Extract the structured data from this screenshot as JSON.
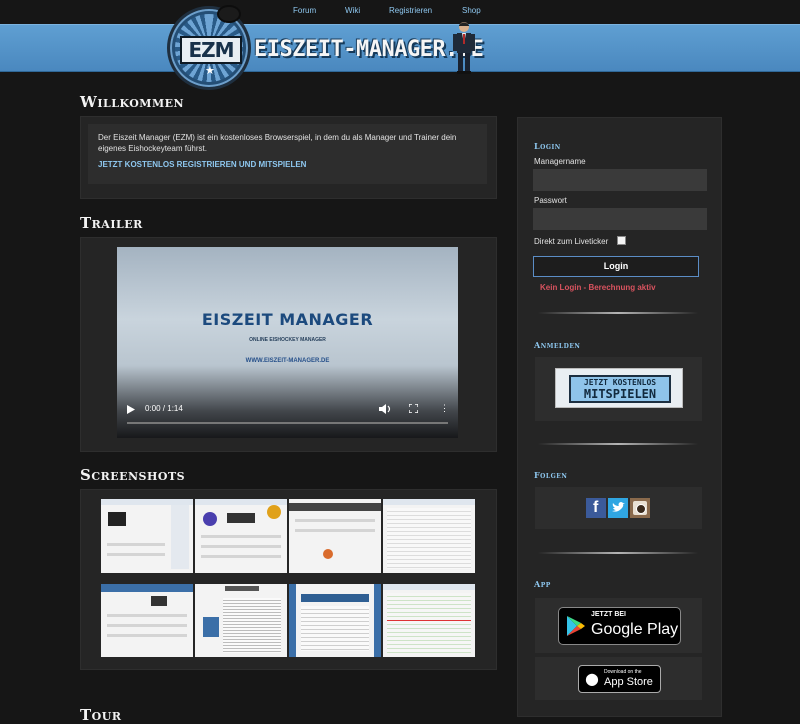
{
  "nav": {
    "items": [
      "Forum",
      "Wiki",
      "Registrieren",
      "Shop"
    ]
  },
  "header": {
    "logo_text": "EZM",
    "site_title": "EISZEIT-MANAGER.DE"
  },
  "welcome": {
    "title": "Willkommen",
    "text": "Der Eiszeit Manager (EZM) ist ein kostenloses Browserspiel, in dem du als Manager und Trainer dein eigenes Eishockeyteam führst.",
    "cta": "JETZT KOSTENLOS REGISTRIEREN UND MITSPIELEN"
  },
  "trailer": {
    "title": "Trailer",
    "video_title": "EISZEIT MANAGER",
    "video_subtitle": "ONLINE EISHOCKEY MANAGER",
    "video_url": "WWW.EISZEIT-MANAGER.DE",
    "time": "0:00 / 1:14",
    "progress": 0
  },
  "screenshots": {
    "title": "Screenshots",
    "count": 8
  },
  "tour": {
    "title": "Tour"
  },
  "sidebar": {
    "login": {
      "title": "Login",
      "username_label": "Managername",
      "password_label": "Passwort",
      "liveticker_label": "Direkt zum Liveticker",
      "button": "Login",
      "warning": "Kein Login - Berechnung aktiv"
    },
    "register": {
      "title": "Anmelden",
      "banner_line1": "JETZT KOSTENLOS",
      "banner_line2": "MITSPIELEN"
    },
    "follow": {
      "title": "Folgen",
      "icons": [
        "facebook-icon",
        "twitter-icon",
        "instagram-icon"
      ]
    },
    "app": {
      "title": "App",
      "google_small": "JETZT BEI",
      "google_big": "Google Play",
      "apple_small": "Download on the",
      "apple_big": "App Store"
    }
  },
  "colors": {
    "accent": "#8ec7ef",
    "banner": "#5f9fd2",
    "background": "#161616",
    "warning": "#d9535f"
  }
}
